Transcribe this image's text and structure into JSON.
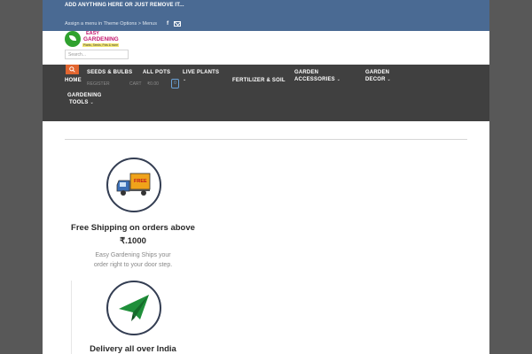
{
  "topbar": {
    "message": "ADD ANYTHING HERE OR JUST REMOVE IT...",
    "menu_note": "Assign a menu in Theme Options > Menus",
    "facebook_glyph": "f"
  },
  "logo": {
    "line1": "EASY",
    "line2": "GARDENING",
    "tagline": "Plants, Seeds, Pots & more"
  },
  "search": {
    "placeholder": "Search..."
  },
  "nav": {
    "home": "HOME",
    "items": [
      {
        "label": "SEEDS & BULBS"
      },
      {
        "label": "ALL POTS"
      },
      {
        "label": "LIVE PLANTS"
      },
      {
        "label": "FERTILIZER & SOIL"
      },
      {
        "label": "GARDEN",
        "label2": "ACCESSORIES"
      },
      {
        "label": "GARDEN",
        "label2": "DECOR"
      },
      {
        "label": "GARDENING",
        "label2": "TOOLS"
      }
    ],
    "register": "REGISTER",
    "cart_label": "CART",
    "cart_amount": "₹0.00",
    "cart_count": "0"
  },
  "features": [
    {
      "icon": "free-shipping-truck-icon",
      "badge": "FREE",
      "title_line1": "Free Shipping on orders above",
      "title_line2": "₹.1000",
      "text_line1": "Easy Gardening Ships your",
      "text_line2": "order right to your door step."
    },
    {
      "icon": "paper-plane-icon",
      "title_line1": "Delivery all over India"
    }
  ],
  "colors": {
    "topbar": "#4a6a93",
    "nav": "#404040",
    "accent": "#e2652f",
    "brand_pink": "#c3176f",
    "brand_green": "#2fa12e"
  }
}
